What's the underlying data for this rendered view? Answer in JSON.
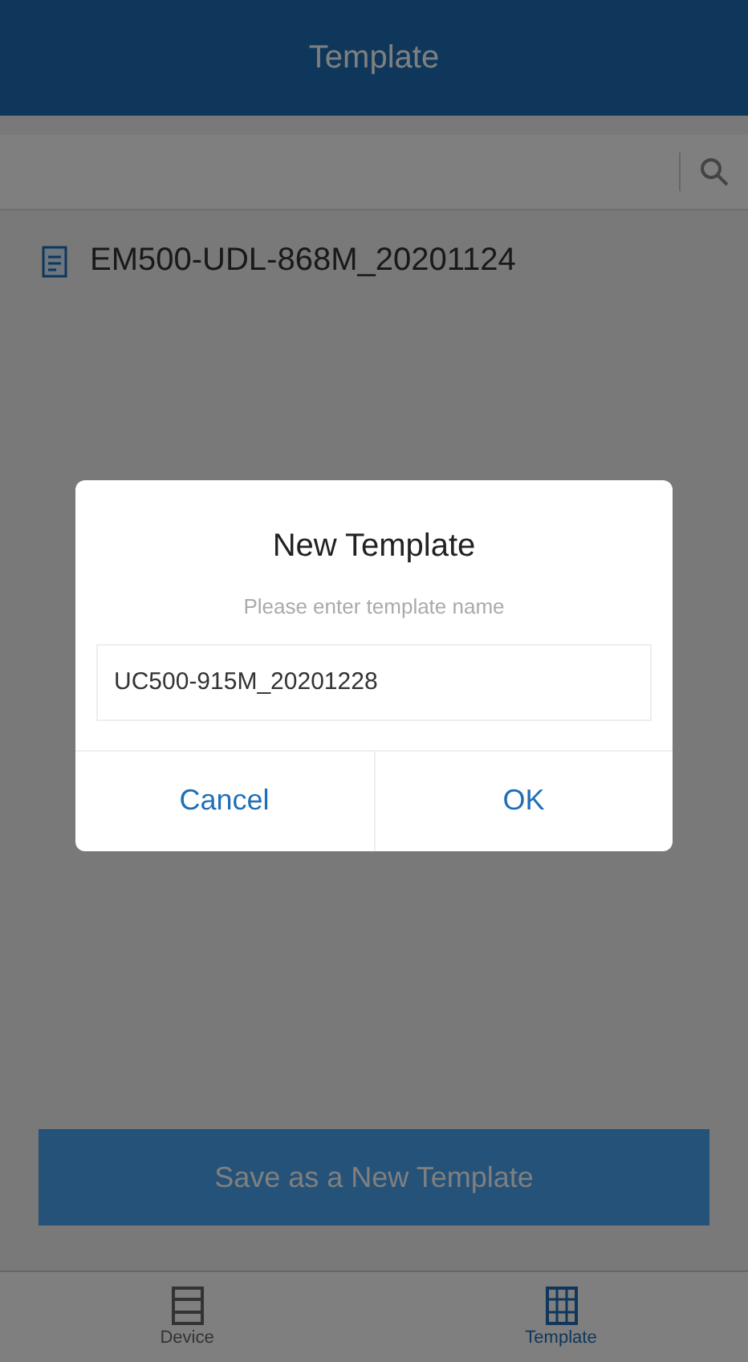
{
  "header": {
    "title": "Template"
  },
  "templates": [
    {
      "name": "EM500-UDL-868M_20201124"
    }
  ],
  "save_button": "Save as a New Template",
  "bottom_nav": [
    {
      "label": "Device",
      "selected": false
    },
    {
      "label": "Template",
      "selected": true
    }
  ],
  "dialog": {
    "title": "New Template",
    "hint": "Please enter template name",
    "value": "UC500-915M_20201228",
    "buttons": [
      "Cancel",
      "OK"
    ]
  }
}
